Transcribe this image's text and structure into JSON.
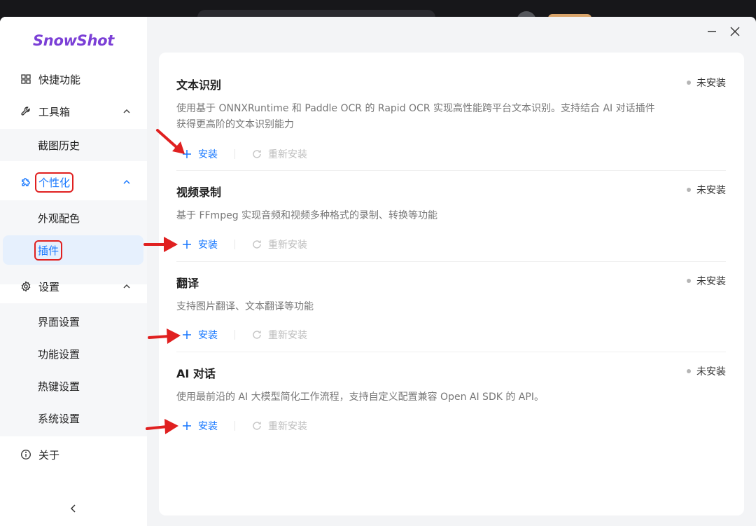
{
  "app": {
    "logo": "SnowShot"
  },
  "sidebar": {
    "items": [
      {
        "label": "快捷功能",
        "icon": "grid-icon"
      },
      {
        "label": "工具箱",
        "icon": "wrench-icon",
        "expanded": true,
        "children": [
          {
            "label": "截图历史"
          }
        ]
      },
      {
        "label": "个性化",
        "icon": "puzzle-icon",
        "expanded": true,
        "active": true,
        "children": [
          {
            "label": "外观配色"
          },
          {
            "label": "插件",
            "selected": true
          }
        ]
      },
      {
        "label": "设置",
        "icon": "gear-icon",
        "expanded": true,
        "children": [
          {
            "label": "界面设置"
          },
          {
            "label": "功能设置"
          },
          {
            "label": "热键设置"
          },
          {
            "label": "系统设置"
          }
        ]
      },
      {
        "label": "关于",
        "icon": "info-icon"
      }
    ],
    "collapse_icon": "chevron-left-icon"
  },
  "window_controls": {
    "minimize_icon": "minimize-icon",
    "close_icon": "close-icon"
  },
  "plugins": [
    {
      "title": "文本识别",
      "status": "未安装",
      "desc_lines": [
        "使用基于 ONNXRuntime 和 Paddle OCR 的 Rapid OCR 实现高性能跨平台文本识别。支持结合 AI 对话插件",
        "获得更高阶的文本识别能力"
      ],
      "install_label": "安装",
      "reinstall_label": "重新安装"
    },
    {
      "title": "视频录制",
      "status": "未安装",
      "desc_lines": [
        "基于 FFmpeg 实现音频和视频多种格式的录制、转换等功能"
      ],
      "install_label": "安装",
      "reinstall_label": "重新安装"
    },
    {
      "title": "翻译",
      "status": "未安装",
      "desc_lines": [
        "支持图片翻译、文本翻译等功能"
      ],
      "install_label": "安装",
      "reinstall_label": "重新安装"
    },
    {
      "title": "AI 对话",
      "status": "未安装",
      "desc_lines": [
        "使用最前沿的 AI 大模型简化工作流程，支持自定义配置兼容 Open AI SDK 的 API。"
      ],
      "install_label": "安装",
      "reinstall_label": "重新安装"
    }
  ],
  "colors": {
    "accent": "#1677ff",
    "logo": "#7b3fd6",
    "annotation": "#e02020",
    "muted": "#bdbdbd"
  }
}
